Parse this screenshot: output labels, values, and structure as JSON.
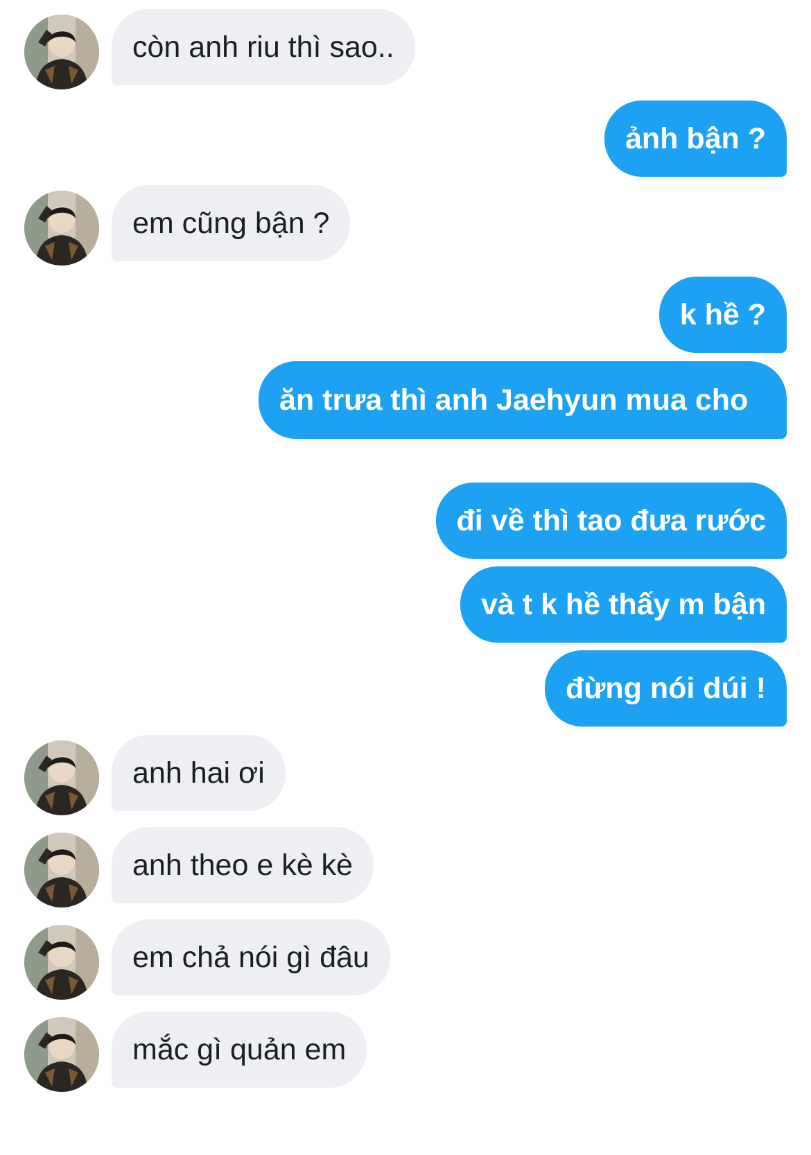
{
  "conversation": {
    "messages": [
      {
        "from": "them",
        "text": "còn anh riu thì sao.."
      },
      {
        "from": "me",
        "text": "ảnh bận ?"
      },
      {
        "from": "them",
        "text": "em cũng bận ?"
      },
      {
        "from": "me",
        "text": "k hề ?"
      },
      {
        "from": "me",
        "text": "ăn trưa thì anh Jaehyun mua cho"
      },
      {
        "from": "me",
        "text": "đi về thì tao đưa rước"
      },
      {
        "from": "me",
        "text": "và t k hề thấy m bận"
      },
      {
        "from": "me",
        "text": "đừng nói dúi !"
      },
      {
        "from": "them",
        "text": "anh hai ơi"
      },
      {
        "from": "them",
        "text": "anh theo e kè kè"
      },
      {
        "from": "them",
        "text": "em chả nói gì đâu"
      },
      {
        "from": "them",
        "text": "mắc gì quản em"
      }
    ]
  },
  "colors": {
    "outgoing_bubble": "#1da1f2",
    "incoming_bubble": "#edeff2",
    "outgoing_text": "#ffffff",
    "incoming_text": "#1b1e22"
  },
  "icons": {
    "sender_avatar": "profile-photo-avatar"
  }
}
